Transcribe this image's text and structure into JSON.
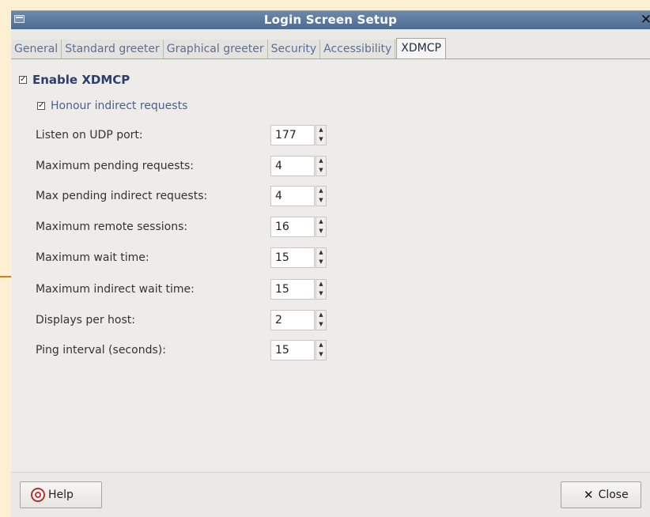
{
  "window": {
    "title": "Login Screen Setup"
  },
  "tabs": [
    {
      "label": "General"
    },
    {
      "label": "Standard greeter"
    },
    {
      "label": "Graphical greeter"
    },
    {
      "label": "Security"
    },
    {
      "label": "Accessibility"
    },
    {
      "label": "XDMCP",
      "active": true
    }
  ],
  "xdmcp": {
    "enable_label": "Enable XDMCP",
    "enable_checked": true,
    "honour_label": "Honour indirect requests",
    "honour_checked": true,
    "fields": [
      {
        "label": "Listen on UDP port:",
        "value": "177"
      },
      {
        "label": "Maximum pending requests:",
        "value": "4"
      },
      {
        "label": "Max pending indirect requests:",
        "value": "4"
      },
      {
        "label": "Maximum remote sessions:",
        "value": "16"
      },
      {
        "label": "Maximum wait time:",
        "value": "15"
      },
      {
        "label": "Maximum indirect wait time:",
        "value": "15"
      },
      {
        "label": "Displays per host:",
        "value": "2"
      },
      {
        "label": "Ping interval (seconds):",
        "value": "15"
      }
    ]
  },
  "footer": {
    "help_label": "Help",
    "close_label": "Close"
  },
  "colors": {
    "titlebar": "#5a7aa0",
    "background": "#fdf0d2",
    "accent_line": "#d27e1c"
  },
  "icons": {
    "help": "help-lifebuoy-icon",
    "close": "close-x-icon"
  }
}
